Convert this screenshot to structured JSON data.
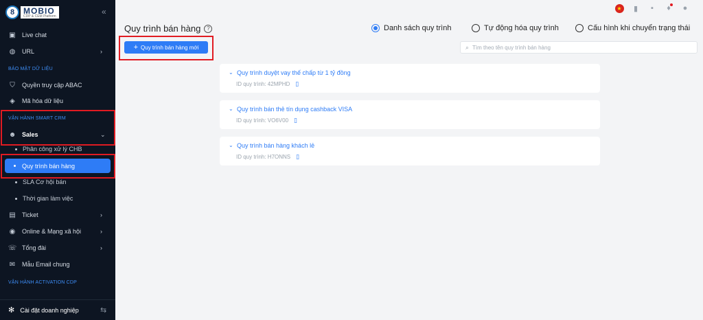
{
  "logo": {
    "text": "MOBIO",
    "tagline": "CDP & CEM Platform",
    "badge": "8"
  },
  "sidebar": {
    "items": [
      {
        "label": "Live chat",
        "icon": "chat-icon"
      },
      {
        "label": "URL",
        "icon": "globe-icon"
      }
    ],
    "sections": {
      "data_security": "BẢO MẬT DỮ LIỆU",
      "smart_crm": "VẬN HÀNH SMART CRM",
      "activation_cdp": "VẬN HÀNH ACTIVATION CDP"
    },
    "security_items": [
      {
        "label": "Quyền truy cập ABAC",
        "icon": "shield-icon"
      },
      {
        "label": "Mã hóa dữ liệu",
        "icon": "layers-icon"
      }
    ],
    "sales": {
      "label": "Sales",
      "icon": "user-icon"
    },
    "sales_sub": [
      "Phân công xử lý CHB",
      "Quy trình bán hàng",
      "SLA Cơ hội bán",
      "Thời gian làm việc"
    ],
    "crm_items": [
      {
        "label": "Ticket",
        "icon": "ticket-icon"
      },
      {
        "label": "Online & Mạng xã hội",
        "icon": "social-icon"
      },
      {
        "label": "Tổng đài",
        "icon": "phone-icon"
      },
      {
        "label": "Mẫu Email chung",
        "icon": "email-icon"
      }
    ],
    "footer": "Cài đặt doanh nghiệp"
  },
  "main": {
    "title": "Quy trình bán hàng",
    "radios": [
      {
        "label": "Danh sách quy trình",
        "selected": true
      },
      {
        "label": "Tự động hóa quy trình",
        "selected": false
      },
      {
        "label": "Cấu hình khi chuyển trạng thái",
        "selected": false
      }
    ],
    "new_button": "Quy trình bán hàng mới",
    "search_placeholder": "Tìm theo tên quy trình bán hàng",
    "processes": [
      {
        "name": "Quy trình duyệt vay thế chấp từ 1 tỷ đồng",
        "id_label": "ID quy trình: 42MPHD"
      },
      {
        "name": "Quy trình bán thẻ tín dụng cashback VISA",
        "id_label": "ID quy trình: VO6V00"
      },
      {
        "name": "Quy trình bán hàng khách lẻ",
        "id_label": "ID quy trình: H7ONNS"
      }
    ]
  },
  "colors": {
    "accent": "#2e7cf6",
    "sidebar_bg": "#0d1522",
    "highlight_box": "#e11b22"
  }
}
